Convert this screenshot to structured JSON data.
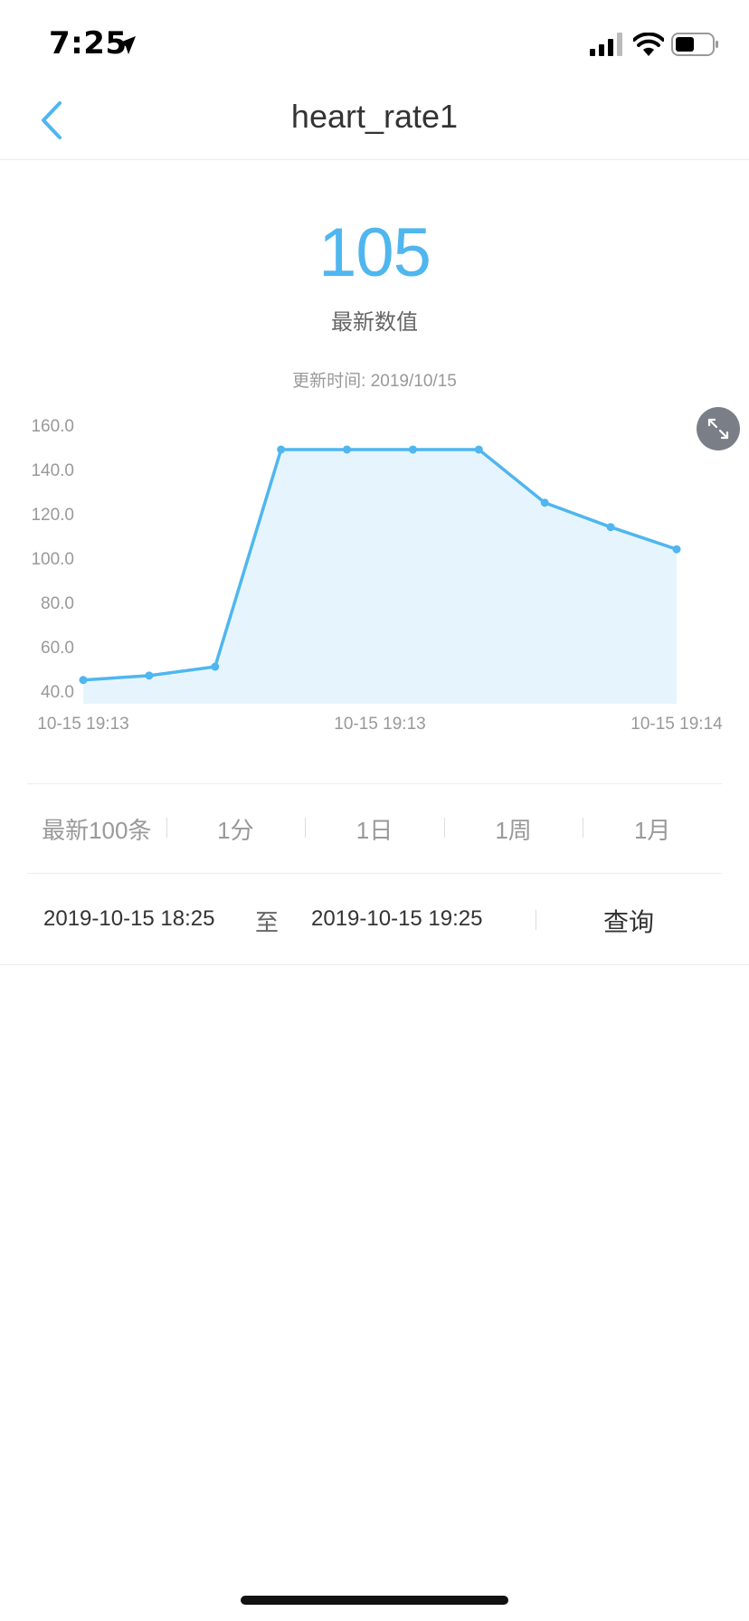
{
  "status_bar": {
    "time": "7:25",
    "icons": [
      "location-arrow-icon",
      "signal-icon",
      "wifi-icon",
      "battery-icon"
    ]
  },
  "nav": {
    "back_icon": "chevron-left-icon",
    "title": "heart_rate1"
  },
  "latest": {
    "value": "105",
    "label": "最新数值",
    "update_text": "更新时间: 2019/10/15"
  },
  "expand_icon": "expand-arrows-icon",
  "filters": [
    {
      "label": "最新100条"
    },
    {
      "label": "1分"
    },
    {
      "label": "1日"
    },
    {
      "label": "1周"
    },
    {
      "label": "1月"
    }
  ],
  "range": {
    "start": "2019-10-15 18:25",
    "separator": "至",
    "end": "2019-10-15 19:25",
    "query_label": "查询"
  },
  "colors": {
    "accent": "#4fb6ef",
    "area_fill": "#e6f5fd",
    "text_gray": "#999999"
  },
  "chart_data": {
    "type": "area",
    "y_ticks": [
      "160.0",
      "140.0",
      "120.0",
      "100.0",
      "80.0",
      "60.0",
      "40.0"
    ],
    "x_tick_labels": [
      "10-15 19:13",
      "10-15 19:13",
      "10-15 19:14"
    ],
    "values": [
      45,
      47,
      51,
      149,
      149,
      149,
      149,
      125,
      114,
      104
    ],
    "ylim": [
      40,
      160
    ],
    "grid": false
  }
}
